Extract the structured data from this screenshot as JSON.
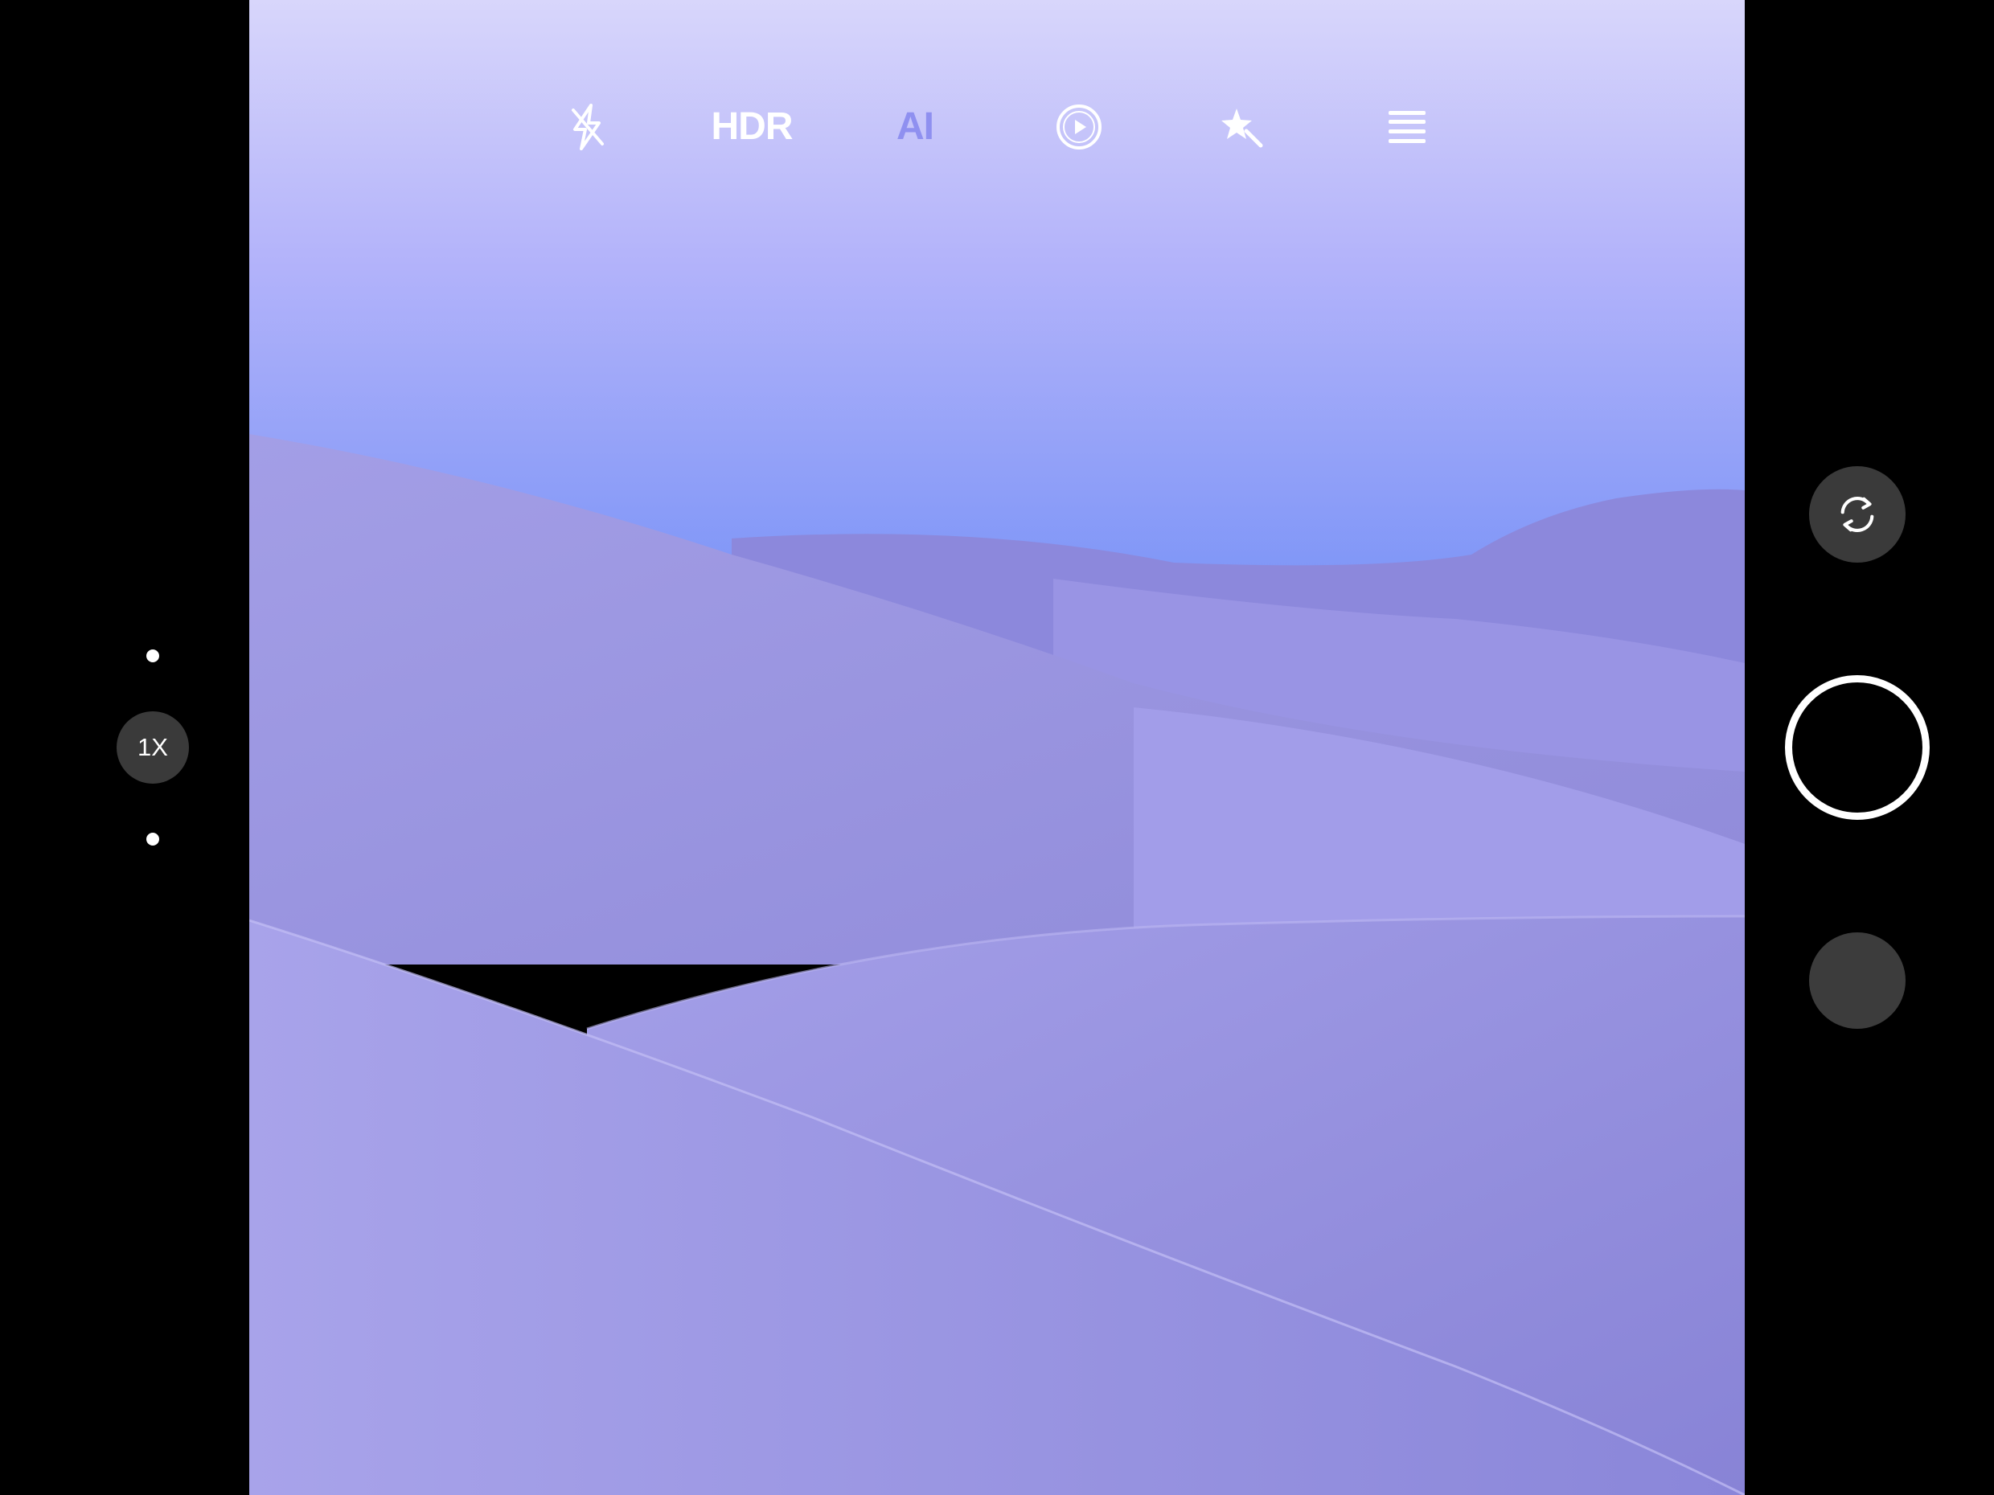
{
  "app": "Camera",
  "toolbar": {
    "flash_icon": "flash-off-icon",
    "hdr_label": "HDR",
    "ai_label": "AI",
    "live_icon": "live-photo-icon",
    "beauty_icon": "magic-star-icon",
    "menu_icon": "hamburger-menu-icon"
  },
  "zoom": {
    "level_label": "1X"
  },
  "controls": {
    "switch_camera_icon": "camera-switch-icon",
    "shutter_icon": "shutter-button",
    "gallery_icon": "gallery-thumbnail"
  },
  "colors": {
    "ai_accent": "#8f90f0",
    "sky_top": "#d8d6fb",
    "sky_bottom": "#7f96f7",
    "dune": "#9c97e3"
  }
}
